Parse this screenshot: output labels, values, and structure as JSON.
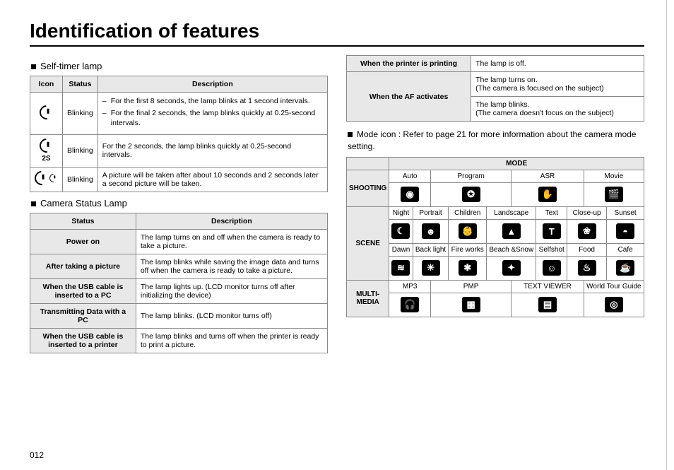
{
  "title": "Identification of features",
  "page_number": "012",
  "sections": {
    "self_timer": {
      "title": "Self-timer lamp",
      "headers": {
        "icon": "Icon",
        "status": "Status",
        "desc": "Description"
      },
      "rows": [
        {
          "icon": "timer",
          "status": "Blinking",
          "desc": [
            "For the first 8 seconds, the lamp blinks at 1 second intervals.",
            "For the final 2 seconds, the lamp blinks quickly at 0.25-second intervals."
          ]
        },
        {
          "icon": "timer-2s",
          "status": "Blinking",
          "desc": "For the 2 seconds, the lamp blinks quickly at 0.25-second intervals."
        },
        {
          "icon": "timer-double",
          "status": "Blinking",
          "desc": "A picture will be taken after about 10 seconds and 2 seconds later a second picture will be taken."
        }
      ]
    },
    "camera_status": {
      "title": "Camera Status Lamp",
      "headers": {
        "status": "Status",
        "desc": "Description"
      },
      "rows": [
        {
          "status": "Power on",
          "desc": "The lamp turns on and off when the camera is ready to take a picture."
        },
        {
          "status": "After taking a picture",
          "desc": "The lamp blinks while saving the image data and turns off when the camera is ready to take a picture."
        },
        {
          "status": "When the USB cable is inserted to a PC",
          "desc": "The lamp lights up. (LCD monitor turns off after initializing the device)"
        },
        {
          "status": "Transmitting Data with a PC",
          "desc": "The lamp blinks. (LCD monitor turns off)"
        },
        {
          "status": "When the USB cable is inserted to a printer",
          "desc": "The lamp blinks and turns off when the printer is ready to print a picture."
        }
      ]
    },
    "printer_af": {
      "rows": [
        {
          "status": "When the printer is printing",
          "desc": "The lamp is off."
        },
        {
          "status": "When the AF activates",
          "desc1": "The lamp turns on.\n(The camera is focused on the subject)",
          "desc2": "The lamp blinks.\n(The camera doesn't focus on the subject)"
        }
      ]
    },
    "mode_icon": {
      "note": "Mode icon : Refer to page 21 for more information about the camera mode setting.",
      "header": "MODE",
      "shooting": {
        "title": "SHOOTING",
        "labels": [
          "Auto",
          "Program",
          "ASR",
          "Movie"
        ],
        "icons": [
          "camera-icon",
          "program-icon",
          "asr-icon",
          "movie-icon"
        ]
      },
      "scene": {
        "title": "SCENE",
        "row1": {
          "labels": [
            "Night",
            "Portrait",
            "Children",
            "Landscape",
            "Text",
            "Close-up",
            "Sunset"
          ],
          "icons": [
            "night-icon",
            "portrait-icon",
            "children-icon",
            "landscape-icon",
            "text-icon",
            "closeup-icon",
            "sunset-icon"
          ]
        },
        "row2": {
          "labels": [
            "Dawn",
            "Back light",
            "Fire works",
            "Beach &Snow",
            "Selfshot",
            "Food",
            "Cafe"
          ],
          "icons": [
            "dawn-icon",
            "backlight-icon",
            "fireworks-icon",
            "beachsnow-icon",
            "selfshot-icon",
            "food-icon",
            "cafe-icon"
          ]
        }
      },
      "multimedia": {
        "title": "MULTI-MEDIA",
        "labels": [
          "MP3",
          "PMP",
          "TEXT VIEWER",
          "World Tour Guide"
        ],
        "icons": [
          "mp3-icon",
          "pmp-icon",
          "textviewer-icon",
          "worldtour-icon"
        ]
      }
    }
  },
  "icon_glyphs": {
    "camera-icon": "◉",
    "program-icon": "✪",
    "asr-icon": "✋",
    "movie-icon": "🎬",
    "night-icon": "☾",
    "portrait-icon": "☻",
    "children-icon": "👶",
    "landscape-icon": "▲",
    "text-icon": "T",
    "closeup-icon": "❀",
    "sunset-icon": "◓",
    "dawn-icon": "≋",
    "backlight-icon": "☀",
    "fireworks-icon": "✱",
    "beachsnow-icon": "✦",
    "selfshot-icon": "☺",
    "food-icon": "♨",
    "cafe-icon": "☕",
    "mp3-icon": "🎧",
    "pmp-icon": "▦",
    "textviewer-icon": "▤",
    "worldtour-icon": "◎"
  }
}
